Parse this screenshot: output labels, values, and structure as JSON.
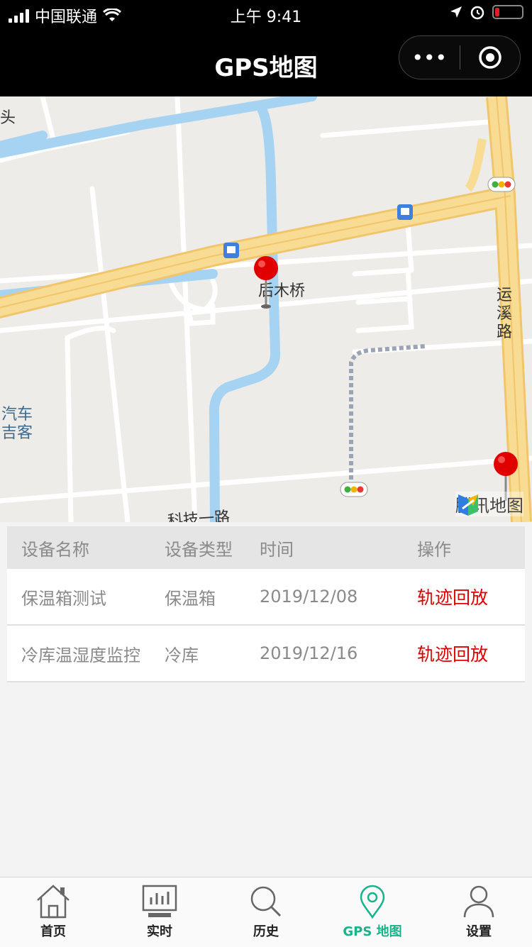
{
  "status_bar": {
    "carrier": "中国联通",
    "time": "上午 9:41"
  },
  "nav": {
    "title": "GPS地图",
    "more_label": "•••"
  },
  "map": {
    "labels": {
      "hou_mu_qiao": "后木桥",
      "yun_xi_lu": "运溪路",
      "ke_ji_yi_lu": "科技一路",
      "qi_che_ji_ke": "汽车\n吉客",
      "top_left": "头"
    },
    "brand": "腾讯地图"
  },
  "table": {
    "headers": [
      "设备名称",
      "设备类型",
      "时间",
      "操作"
    ],
    "rows": [
      {
        "name": "保温箱测试",
        "type": "保温箱",
        "time": "2019/12/08",
        "action": "轨迹回放"
      },
      {
        "name": "冷库温湿度监控",
        "type": "冷库",
        "time": "2019/12/16",
        "action": "轨迹回放"
      }
    ]
  },
  "tabbar": {
    "items": [
      {
        "label": "首页",
        "icon": "home-icon"
      },
      {
        "label": "实时",
        "icon": "monitor-icon"
      },
      {
        "label": "历史",
        "icon": "search-icon"
      },
      {
        "label": "GPS 地图",
        "icon": "location-pin-icon",
        "active": true
      },
      {
        "label": "设置",
        "icon": "user-icon"
      }
    ]
  },
  "colors": {
    "accent": "#19b38b",
    "action_red": "#e00000",
    "map_road": "#f8d98a",
    "map_water": "#9fd0f2"
  }
}
